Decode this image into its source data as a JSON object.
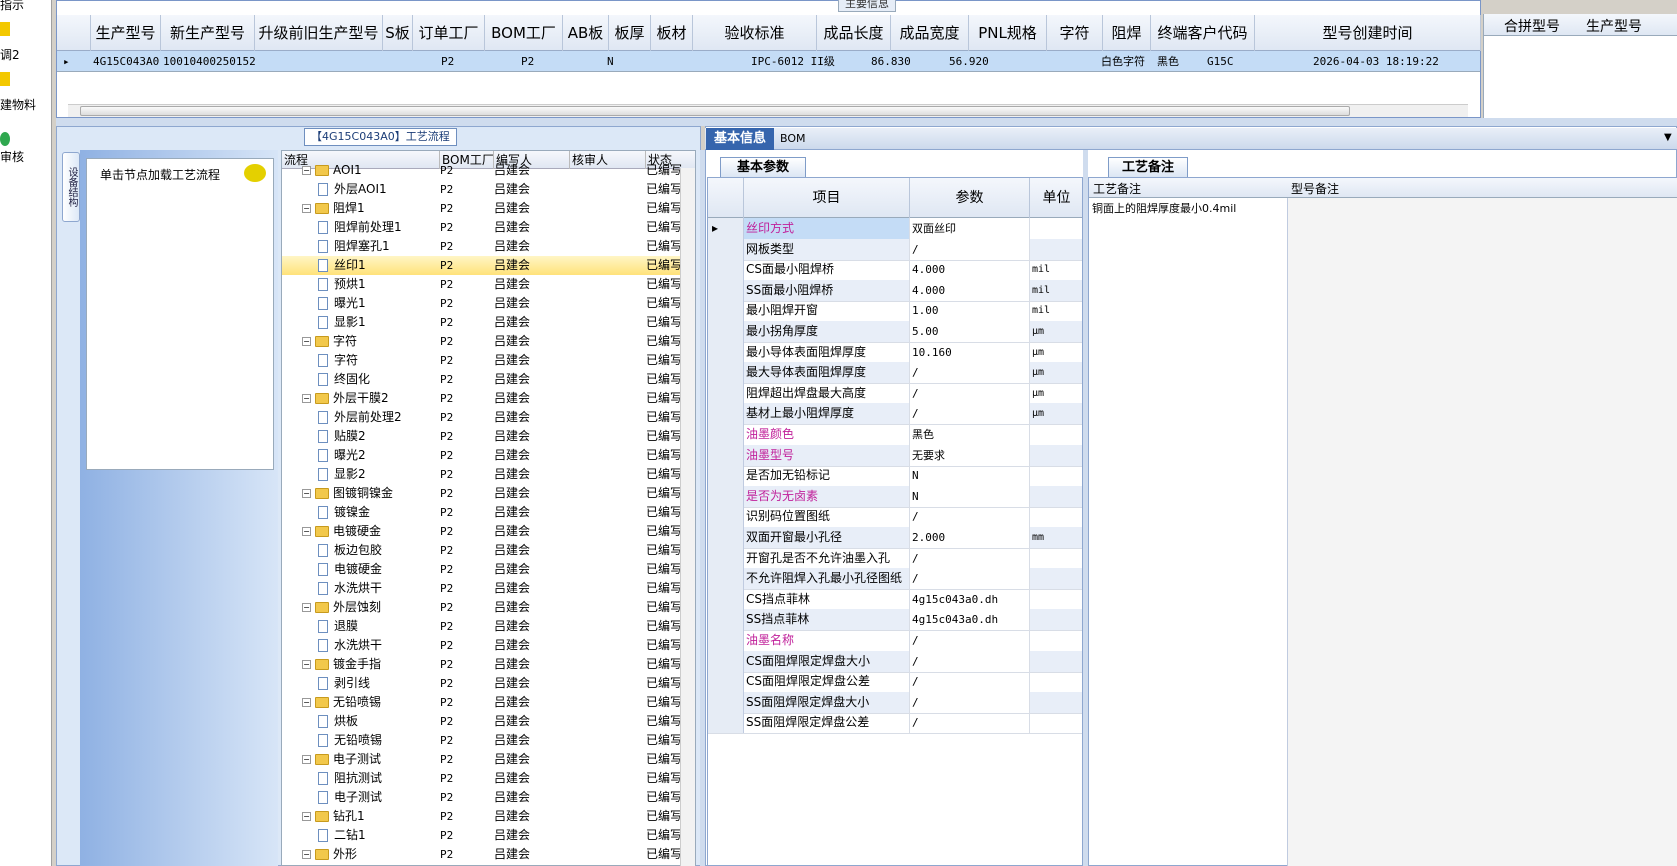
{
  "leftnav": {
    "items": [
      "指示",
      "调2",
      "建物料",
      "审核"
    ]
  },
  "top": {
    "caption": "主要信息",
    "headers": [
      "生产型号",
      "新生产型号",
      "升级前旧生产型号",
      "S板",
      "订单工厂",
      "BOM工厂",
      "AB板",
      "板厚",
      "板材",
      "验收标准",
      "成品长度",
      "成品宽度",
      "PNL规格",
      "字符",
      "阻焊",
      "终端客户代码",
      "型号创建时间"
    ],
    "row": [
      "4G15C043A0",
      "10010400250152",
      "",
      "",
      "P2",
      "P2",
      "N",
      "",
      "",
      "IPC-6012 II级",
      "86.830",
      "56.920",
      "",
      "白色字符",
      "黑色",
      "G15C",
      "2026-04-03 18:19:22"
    ],
    "merge_headers": [
      "合拼型号",
      "生产型号"
    ]
  },
  "process": {
    "title": "【4G15C043A0】工艺流程",
    "side_tab": "设备结构",
    "hint": "单击节点加载工艺流程",
    "headers": [
      "流程",
      "BOM工厂",
      "编写人",
      "核审人",
      "状态"
    ],
    "rows": [
      {
        "name": "AOI1",
        "folder": true,
        "lvl": 1,
        "f": "P2",
        "w": "吕建会",
        "s": "已编写"
      },
      {
        "name": "外层AOI1",
        "folder": false,
        "lvl": 2,
        "f": "P2",
        "w": "吕建会",
        "s": "已编写"
      },
      {
        "name": "阻焊1",
        "folder": true,
        "lvl": 1,
        "f": "P2",
        "w": "吕建会",
        "s": "已编写"
      },
      {
        "name": "阻焊前处理1",
        "folder": false,
        "lvl": 2,
        "f": "P2",
        "w": "吕建会",
        "s": "已编写"
      },
      {
        "name": "阻焊塞孔1",
        "folder": false,
        "lvl": 2,
        "f": "P2",
        "w": "吕建会",
        "s": "已编写"
      },
      {
        "name": "丝印1",
        "folder": false,
        "lvl": 2,
        "f": "P2",
        "w": "吕建会",
        "s": "已编写",
        "sel": true
      },
      {
        "name": "预烘1",
        "folder": false,
        "lvl": 2,
        "f": "P2",
        "w": "吕建会",
        "s": "已编写"
      },
      {
        "name": "曝光1",
        "folder": false,
        "lvl": 2,
        "f": "P2",
        "w": "吕建会",
        "s": "已编写"
      },
      {
        "name": "显影1",
        "folder": false,
        "lvl": 2,
        "f": "P2",
        "w": "吕建会",
        "s": "已编写"
      },
      {
        "name": "字符",
        "folder": true,
        "lvl": 1,
        "f": "P2",
        "w": "吕建会",
        "s": "已编写"
      },
      {
        "name": "字符",
        "folder": false,
        "lvl": 2,
        "f": "P2",
        "w": "吕建会",
        "s": "已编写"
      },
      {
        "name": "终固化",
        "folder": false,
        "lvl": 2,
        "f": "P2",
        "w": "吕建会",
        "s": "已编写"
      },
      {
        "name": "外层干膜2",
        "folder": true,
        "lvl": 1,
        "f": "P2",
        "w": "吕建会",
        "s": "已编写"
      },
      {
        "name": "外层前处理2",
        "folder": false,
        "lvl": 2,
        "f": "P2",
        "w": "吕建会",
        "s": "已编写"
      },
      {
        "name": "贴膜2",
        "folder": false,
        "lvl": 2,
        "f": "P2",
        "w": "吕建会",
        "s": "已编写"
      },
      {
        "name": "曝光2",
        "folder": false,
        "lvl": 2,
        "f": "P2",
        "w": "吕建会",
        "s": "已编写"
      },
      {
        "name": "显影2",
        "folder": false,
        "lvl": 2,
        "f": "P2",
        "w": "吕建会",
        "s": "已编写"
      },
      {
        "name": "图镀铜镍金",
        "folder": true,
        "lvl": 1,
        "f": "P2",
        "w": "吕建会",
        "s": "已编写"
      },
      {
        "name": "镀镍金",
        "folder": false,
        "lvl": 2,
        "f": "P2",
        "w": "吕建会",
        "s": "已编写"
      },
      {
        "name": "电镀硬金",
        "folder": true,
        "lvl": 1,
        "f": "P2",
        "w": "吕建会",
        "s": "已编写"
      },
      {
        "name": "板边包胶",
        "folder": false,
        "lvl": 2,
        "f": "P2",
        "w": "吕建会",
        "s": "已编写"
      },
      {
        "name": "电镀硬金",
        "folder": false,
        "lvl": 2,
        "f": "P2",
        "w": "吕建会",
        "s": "已编写"
      },
      {
        "name": "水洗烘干",
        "folder": false,
        "lvl": 2,
        "f": "P2",
        "w": "吕建会",
        "s": "已编写"
      },
      {
        "name": "外层蚀刻",
        "folder": true,
        "lvl": 1,
        "f": "P2",
        "w": "吕建会",
        "s": "已编写"
      },
      {
        "name": "退膜",
        "folder": false,
        "lvl": 2,
        "f": "P2",
        "w": "吕建会",
        "s": "已编写"
      },
      {
        "name": "水洗烘干",
        "folder": false,
        "lvl": 2,
        "f": "P2",
        "w": "吕建会",
        "s": "已编写"
      },
      {
        "name": "镀金手指",
        "folder": true,
        "lvl": 1,
        "f": "P2",
        "w": "吕建会",
        "s": "已编写"
      },
      {
        "name": "剥引线",
        "folder": false,
        "lvl": 2,
        "f": "P2",
        "w": "吕建会",
        "s": "已编写"
      },
      {
        "name": "无铅喷锡",
        "folder": true,
        "lvl": 1,
        "f": "P2",
        "w": "吕建会",
        "s": "已编写"
      },
      {
        "name": "烘板",
        "folder": false,
        "lvl": 2,
        "f": "P2",
        "w": "吕建会",
        "s": "已编写"
      },
      {
        "name": "无铅喷锡",
        "folder": false,
        "lvl": 2,
        "f": "P2",
        "w": "吕建会",
        "s": "已编写"
      },
      {
        "name": "电子测试",
        "folder": true,
        "lvl": 1,
        "f": "P2",
        "w": "吕建会",
        "s": "已编写"
      },
      {
        "name": "阻抗测试",
        "folder": false,
        "lvl": 2,
        "f": "P2",
        "w": "吕建会",
        "s": "已编写"
      },
      {
        "name": "电子测试",
        "folder": false,
        "lvl": 2,
        "f": "P2",
        "w": "吕建会",
        "s": "已编写"
      },
      {
        "name": "钻孔1",
        "folder": true,
        "lvl": 1,
        "f": "P2",
        "w": "吕建会",
        "s": "已编写"
      },
      {
        "name": "二钻1",
        "folder": false,
        "lvl": 2,
        "f": "P2",
        "w": "吕建会",
        "s": "已编写"
      },
      {
        "name": "外形",
        "folder": true,
        "lvl": 1,
        "f": "P2",
        "w": "吕建会",
        "s": "已编写"
      }
    ]
  },
  "info": {
    "tabs": [
      "基本信息",
      "BOM"
    ],
    "subtab": "基本参数",
    "notes_tab": "工艺备注",
    "param_headers": [
      "项目",
      "参数",
      "单位"
    ],
    "params": [
      {
        "k": "丝印方式",
        "v": "双面丝印",
        "u": "",
        "pink": true
      },
      {
        "k": "网板类型",
        "v": "/",
        "u": ""
      },
      {
        "k": "CS面最小阻焊桥",
        "v": "4.000",
        "u": "mil"
      },
      {
        "k": "SS面最小阻焊桥",
        "v": "4.000",
        "u": "mil"
      },
      {
        "k": "最小阻焊开窗",
        "v": "1.00",
        "u": "mil"
      },
      {
        "k": "最小拐角厚度",
        "v": "5.00",
        "u": "μm"
      },
      {
        "k": "最小导体表面阻焊厚度",
        "v": "10.160",
        "u": "μm"
      },
      {
        "k": "最大导体表面阻焊厚度",
        "v": "/",
        "u": "μm"
      },
      {
        "k": "阻焊超出焊盘最大高度",
        "v": "/",
        "u": "μm"
      },
      {
        "k": "基材上最小阻焊厚度",
        "v": "/",
        "u": "μm"
      },
      {
        "k": "油墨颜色",
        "v": "黑色",
        "u": "",
        "pink": true
      },
      {
        "k": "油墨型号",
        "v": "无要求",
        "u": "",
        "pink": true
      },
      {
        "k": "是否加无铅标记",
        "v": "N",
        "u": ""
      },
      {
        "k": "是否为无卤素",
        "v": "N",
        "u": "",
        "pink": true
      },
      {
        "k": "识别码位置图纸",
        "v": "/",
        "u": ""
      },
      {
        "k": "双面开窗最小孔径",
        "v": "2.000",
        "u": "mm"
      },
      {
        "k": "开窗孔是否不允许油墨入孔",
        "v": "/",
        "u": ""
      },
      {
        "k": "不允许阻焊入孔最小孔径图纸",
        "v": "/",
        "u": ""
      },
      {
        "k": "CS挡点菲林",
        "v": "4g15c043a0.dh",
        "u": ""
      },
      {
        "k": "SS挡点菲林",
        "v": "4g15c043a0.dh",
        "u": ""
      },
      {
        "k": "油墨名称",
        "v": "/",
        "u": "",
        "pink": true
      },
      {
        "k": "CS面阻焊限定焊盘大小",
        "v": "/",
        "u": ""
      },
      {
        "k": "CS面阻焊限定焊盘公差",
        "v": "/",
        "u": ""
      },
      {
        "k": "SS面阻焊限定焊盘大小",
        "v": "/",
        "u": ""
      },
      {
        "k": "SS面阻焊限定焊盘公差",
        "v": "/",
        "u": ""
      }
    ],
    "notes_headers": [
      "工艺备注",
      "型号备注"
    ],
    "process_note": "铜面上的阻焊厚度最小0.4mil",
    "model_note": ""
  }
}
